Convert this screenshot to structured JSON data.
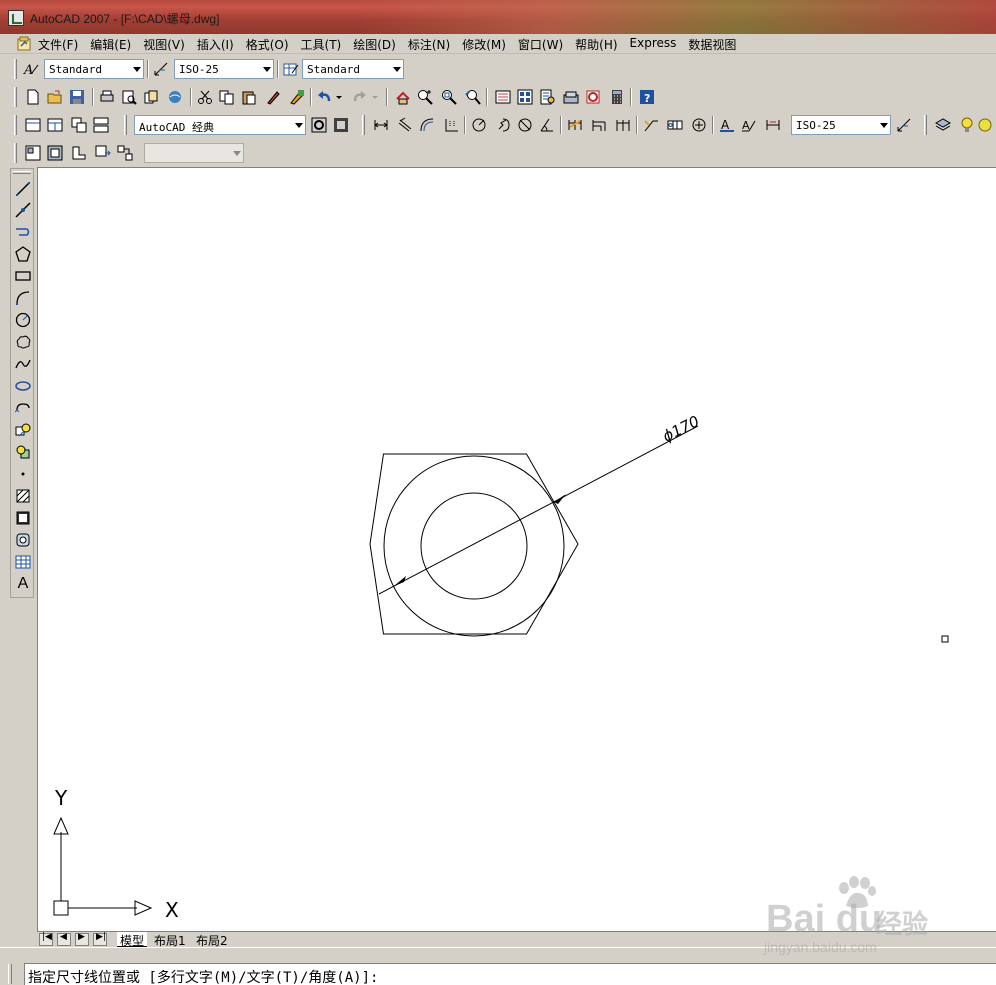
{
  "window": {
    "title": "AutoCAD 2007 - [F:\\CAD\\螺母.dwg]"
  },
  "menu": {
    "items": [
      "文件(F)",
      "编辑(E)",
      "视图(V)",
      "插入(I)",
      "格式(O)",
      "工具(T)",
      "绘图(D)",
      "标注(N)",
      "修改(M)",
      "窗口(W)",
      "帮助(H)",
      "Express",
      "数据视图"
    ]
  },
  "styles_toolbar": {
    "text_style": "Standard",
    "dim_style": "ISO-25",
    "table_style": "Standard"
  },
  "workspace_toolbar": {
    "workspace": "AutoCAD 经典"
  },
  "dimension_toolbar": {
    "dim_style": "ISO-25"
  },
  "drawing": {
    "dimension_text": "ϕ170",
    "ucs_x_label": "X",
    "ucs_y_label": "Y"
  },
  "layout_tabs": [
    "模型",
    "布局1",
    "布局2"
  ],
  "command_line": {
    "prompt": "指定尺寸线位置或 [多行文字(M)/文字(T)/角度(A)]:"
  },
  "watermark": {
    "brand": "Bai du",
    "cn": "经验",
    "url": "jingyan.baidu.com"
  },
  "colors": {
    "titlebar": "#a23d33",
    "canvas_bg": "#ffffff",
    "chrome": "#d4d0c8",
    "line": "#000000"
  }
}
